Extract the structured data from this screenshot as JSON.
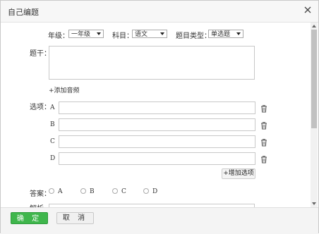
{
  "dialog": {
    "title": "自己编题"
  },
  "filters": {
    "grade_label": "年级：",
    "grade_value": "一年级",
    "subject_label": "科目：",
    "subject_value": "语文",
    "type_label": "题目类型：",
    "type_value": "单选题"
  },
  "stem": {
    "label": "题干：",
    "add_audio": "+添加音频"
  },
  "options": {
    "label": "选项：",
    "items": [
      {
        "letter": "A",
        "value": ""
      },
      {
        "letter": "B",
        "value": ""
      },
      {
        "letter": "C",
        "value": ""
      },
      {
        "letter": "D",
        "value": ""
      }
    ],
    "add_label": "+增加选项"
  },
  "answer": {
    "label": "答案：",
    "choices": [
      "A",
      "B",
      "C",
      "D"
    ]
  },
  "analysis": {
    "label": "解析"
  },
  "footer": {
    "ok": "确 定",
    "cancel": "取 消"
  },
  "icons": {
    "close": "close-icon",
    "trash": "trash-icon",
    "select_arrow": "chevron-down-icon"
  },
  "colors": {
    "ok_button": "#3fb64c",
    "border": "#c8c8c8"
  }
}
